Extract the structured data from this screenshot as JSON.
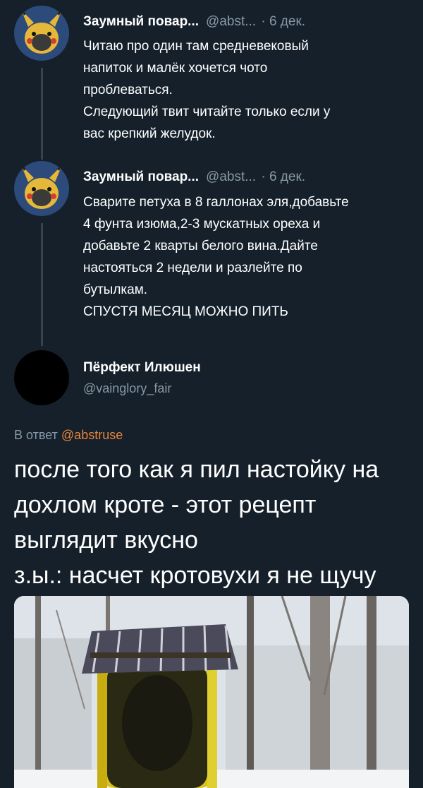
{
  "tweets": [
    {
      "name": "Заумный повар...",
      "handle": "@abst...",
      "date": "· 6 дек.",
      "lines": [
        "Читаю про один там средневековый",
        "напиток и малёк хочется чото",
        "проблеваться.",
        "Следующий твит читайте только если у",
        "вас крепкий желудок."
      ]
    },
    {
      "name": "Заумный повар...",
      "handle": "@abst...",
      "date": "· 6 дек.",
      "lines": [
        "Сварите петуха в 8 галлонах эля,добавьте",
        "4 фунта изюма,2-3 мускатных ореха и",
        "добавьте 2 кварты белого вина.Дайте",
        "настояться 2 недели и разлейте по",
        "бутылкам.",
        "СПУСТЯ МЕСЯЦ МОЖНО ПИТЬ"
      ]
    }
  ],
  "reply": {
    "name": "Пёрфект Илюшен",
    "handle": "@vainglory_fair",
    "reply_prefix": "В ответ",
    "reply_to": "@abstruse",
    "lines": [
      "после того как я пил настойку на",
      "дохлом кроте - этот рецепт",
      "выглядит вкусно",
      "з.ы.: насчет кротовухи я не щучу"
    ]
  },
  "colors": {
    "background": "#15202b",
    "secondary_text": "#8899a6",
    "link": "#e8843a",
    "avatar_bg": "#2c4a7a"
  }
}
